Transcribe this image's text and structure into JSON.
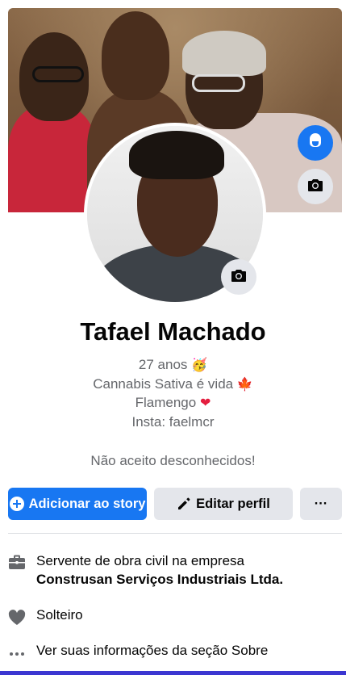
{
  "profile": {
    "name": "Tafael Machado",
    "bio": {
      "age": "27 anos",
      "age_emoji": "🥳",
      "line2": "Cannabis Sativa é vida",
      "line2_emoji": "🍁",
      "line3": "Flamengo",
      "line3_emoji": "❤",
      "line4": "Insta: faelmcr"
    },
    "tagline": "Não aceito desconhecidos!"
  },
  "actions": {
    "add_story": "Adicionar ao story",
    "edit_profile": "Editar perfil",
    "more": "···"
  },
  "about": {
    "work_prefix": "Servente de obra civil na empresa",
    "work_company": "Construsan Serviços Industriais Ltda.",
    "relationship": "Solteiro",
    "see_more": "Ver suas informações da seção Sobre"
  },
  "icons": {
    "avatar_style": "avatar-icon",
    "cover_camera": "camera-icon",
    "avatar_camera": "camera-icon",
    "add": "plus-circle-icon",
    "edit": "pencil-icon",
    "more": "ellipsis-icon",
    "work": "briefcase-icon",
    "relationship": "heart-icon",
    "see_more": "ellipsis-icon"
  },
  "colors": {
    "primary": "#1877f2",
    "secondary_button": "#e4e6eb",
    "muted_text": "#65676b"
  }
}
